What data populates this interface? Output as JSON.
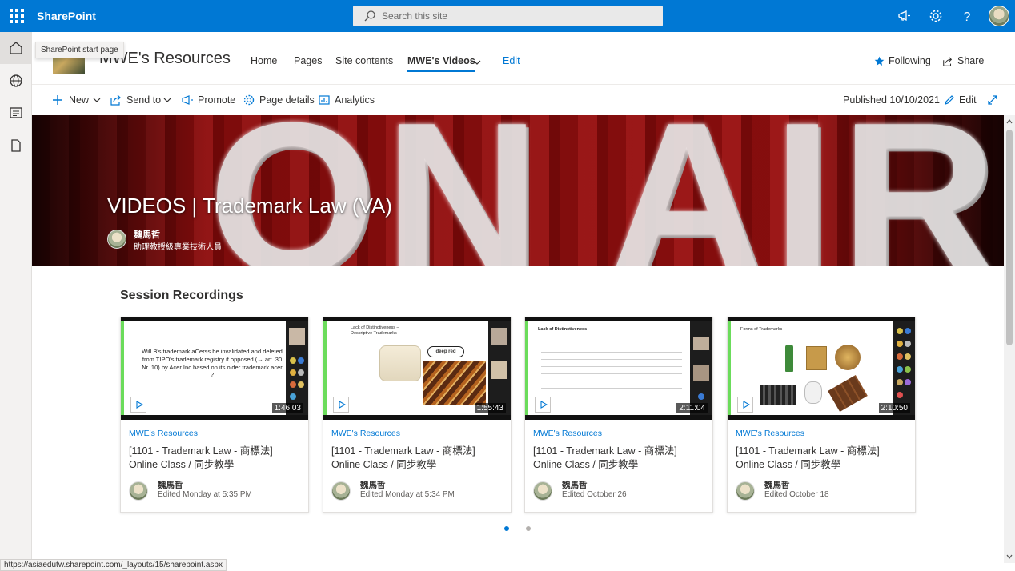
{
  "suitebar": {
    "brand": "SharePoint",
    "search_placeholder": "Search this site"
  },
  "tooltip": "SharePoint start page",
  "site": {
    "title": "MWE's Resources",
    "nav": [
      "Home",
      "Pages",
      "Site contents",
      "MWE's Videos",
      "Edit"
    ],
    "following": "Following",
    "share": "Share"
  },
  "command_bar": {
    "new": "New",
    "send_to": "Send to",
    "promote": "Promote",
    "page_details": "Page details",
    "analytics": "Analytics",
    "published": "Published 10/10/2021",
    "edit": "Edit"
  },
  "hero": {
    "bg_text": "ON AIR",
    "title": "VIDEOS | Trademark Law (VA)",
    "author": "魏馬哲",
    "role": "助理教授級專業技術人員"
  },
  "section": {
    "title": "Session Recordings",
    "cards": [
      {
        "site": "MWE's Resources",
        "title": "[1101 - Trademark Law - 商標法] Online Class / 同步教學",
        "author": "魏馬哲",
        "edited": "Edited Monday at 5:35 PM",
        "duration": "1:46:03",
        "slide_text": "Will B's trademark aCerss be invalidated and deleted from TIPO's trademark registry if opposed (→ art. 30 Nr. 10) by Acer Inc based on its older trademark acer ?"
      },
      {
        "site": "MWE's Resources",
        "title": "[1101 - Trademark Law - 商標法] Online Class / 同步教學",
        "author": "魏馬哲",
        "edited": "Edited Monday at 5:34 PM",
        "duration": "1:55:43",
        "slide_text": "Lack of Distinctiveness – Descriptive Trademarks"
      },
      {
        "site": "MWE's Resources",
        "title": "[1101 - Trademark Law - 商標法] Online Class / 同步教學",
        "author": "魏馬哲",
        "edited": "Edited October 26",
        "duration": "2:11:04",
        "slide_text": "Lack of Distinctiveness"
      },
      {
        "site": "MWE's Resources",
        "title": "[1101 - Trademark Law - 商標法] Online Class / 同步教學",
        "author": "魏馬哲",
        "edited": "Edited October 18",
        "duration": "2:10:50",
        "slide_text": "Forms of Trademarks"
      }
    ]
  },
  "pager": {
    "pages": 2,
    "current": 1
  },
  "status_url": "https://asiaedutw.sharepoint.com/_layouts/15/sharepoint.aspx",
  "colors": {
    "suitebar": "#0078d4",
    "accent": "#0078d4",
    "hero_red": "#a81b1b"
  }
}
